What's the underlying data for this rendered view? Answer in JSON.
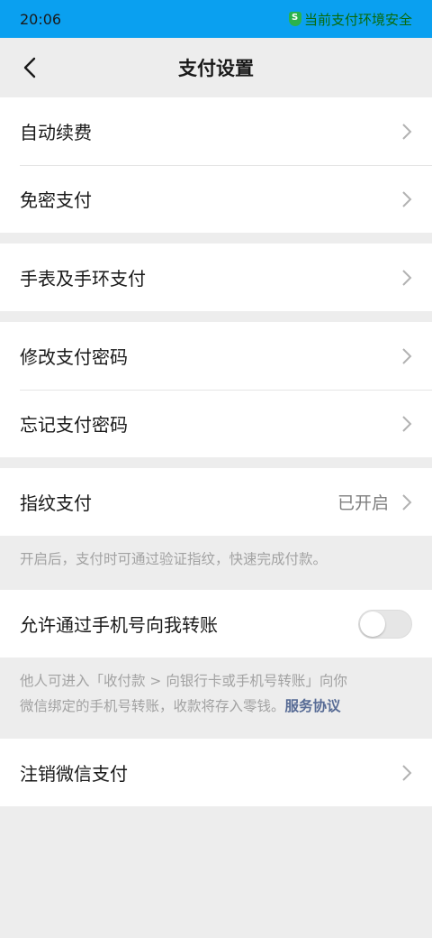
{
  "status_bar": {
    "time": "20:06",
    "security_text": "当前支付环境安全"
  },
  "nav": {
    "title": "支付设置",
    "back_icon": "chevron-left-icon"
  },
  "groups": {
    "g1": [
      {
        "label": "自动续费"
      },
      {
        "label": "免密支付"
      }
    ],
    "g2": [
      {
        "label": "手表及手环支付"
      }
    ],
    "g3": [
      {
        "label": "修改支付密码"
      },
      {
        "label": "忘记支付密码"
      }
    ],
    "fingerprint": {
      "label": "指纹支付",
      "value": "已开启",
      "note": "开启后，支付时可通过验证指纹，快速完成付款。"
    },
    "phone_transfer": {
      "label": "允许通过手机号向我转账",
      "enabled": false,
      "note_line1": "他人可进入「收付款 > 向银行卡或手机号转账」向你",
      "note_line2": "微信绑定的手机号转账，收款将存入零钱。",
      "note_link": "服务协议"
    },
    "g5": [
      {
        "label": "注销微信支付"
      }
    ]
  },
  "colors": {
    "status_bar": "#0aa0f0",
    "background": "#ededed",
    "link": "#576b95"
  }
}
